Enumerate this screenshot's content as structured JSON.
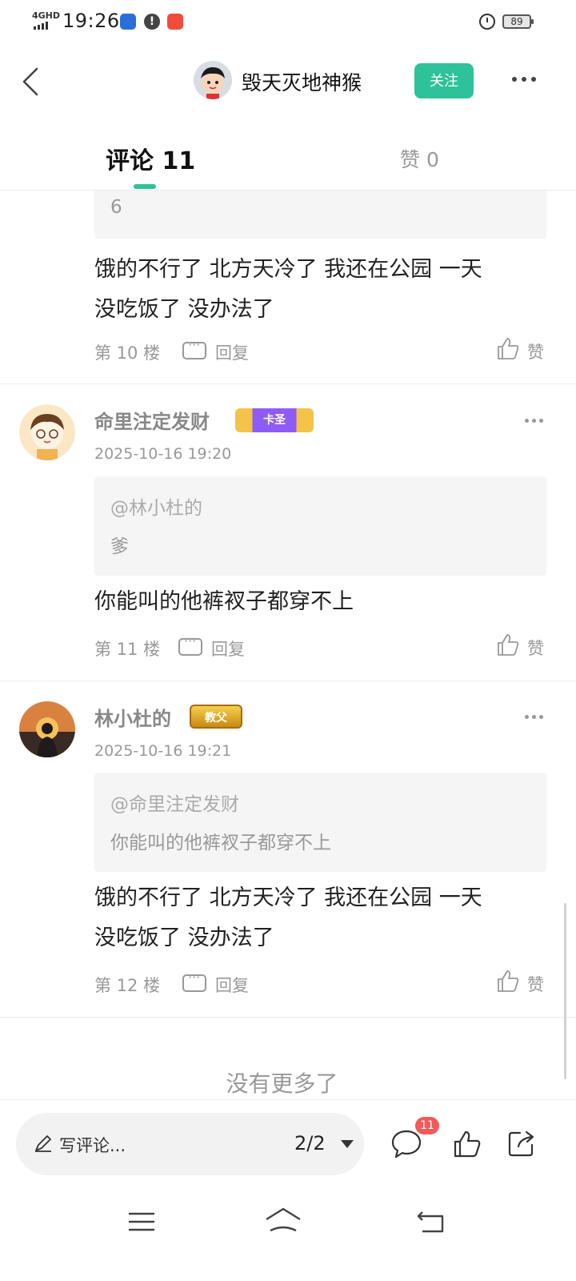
{
  "status_bar": {
    "network": "4GHD",
    "time": "19:26",
    "notification_alert": "!",
    "battery": "89"
  },
  "header": {
    "author_name": "毁天灭地神猴",
    "follow_label": "关注"
  },
  "tabs": {
    "comments_label": "评论",
    "comments_count": "11",
    "likes_label": "赞",
    "likes_count": "0"
  },
  "partial_comment": {
    "quote_tail": "6",
    "text_line1": "饿的不行了 北方天冷了 我还在公园 一天",
    "text_line2": "没吃饭了 没办法了",
    "floor": "第 10 楼",
    "reply_label": "回复",
    "like_label": "赞"
  },
  "comments": [
    {
      "username": "命里注定发财",
      "badge": "卡圣",
      "timestamp": "2025-10-16 19:20",
      "quote_at": "@林小杜的",
      "quote_body": "爹",
      "text": "你能叫的他裤衩子都穿不上",
      "floor": "第 11 楼",
      "reply_label": "回复",
      "like_label": "赞"
    },
    {
      "username": "林小杜的",
      "badge": "教父",
      "timestamp": "2025-10-16 19:21",
      "quote_at": "@命里注定发财",
      "quote_body": "你能叫的他裤衩子都穿不上",
      "text_line1": "饿的不行了 北方天冷了 我还在公园 一天",
      "text_line2": "没吃饭了 没办法了",
      "floor": "第 12 楼",
      "reply_label": "回复",
      "like_label": "赞"
    }
  ],
  "no_more": "没有更多了",
  "action_bar": {
    "input_placeholder": "写评论...",
    "page_indicator": "2/2",
    "comment_count_badge": "11"
  },
  "colors": {
    "accent": "#2ec29a",
    "badge_red": "#f25a5a"
  },
  "icons": [
    "back-icon",
    "more-icon",
    "reply-icon",
    "like-icon",
    "pencil-icon",
    "comment-bubble-icon",
    "thumb-icon",
    "share-icon",
    "menu-icon",
    "home-icon",
    "return-icon"
  ]
}
